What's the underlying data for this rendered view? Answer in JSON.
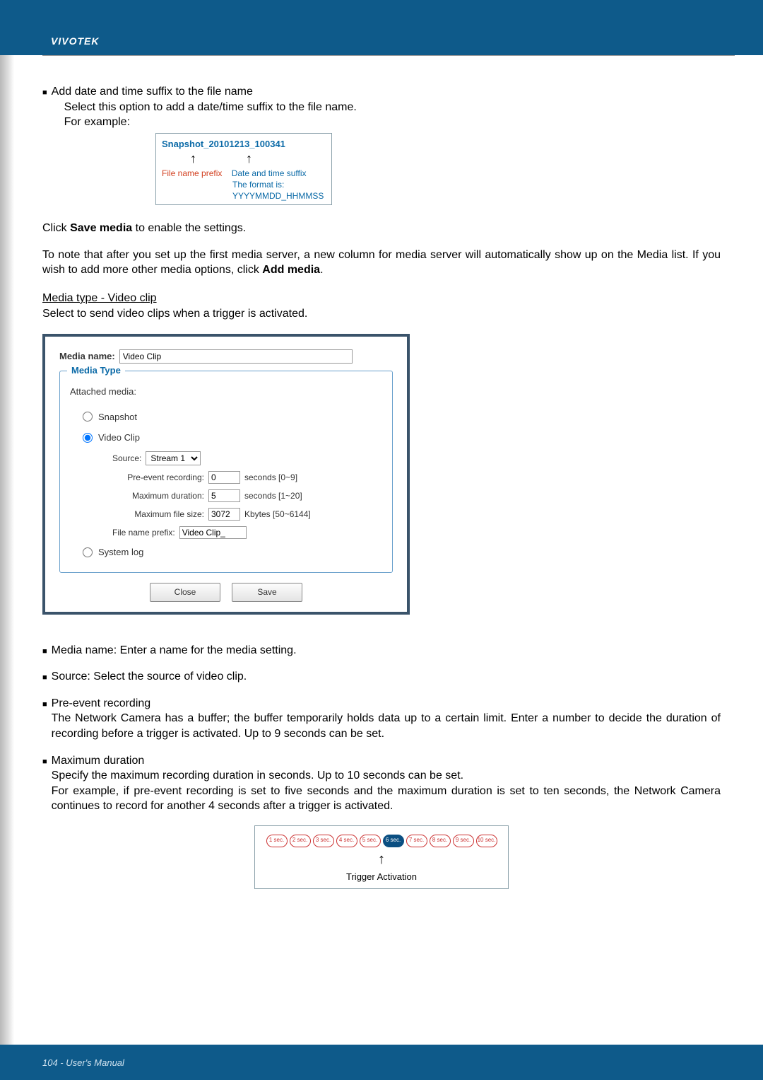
{
  "brand": "VIVOTEK",
  "intro": {
    "bullet_title": "Add date and time suffix to the file name",
    "line1": "Select this option to add a date/time suffix to the file name.",
    "line2": "For example:"
  },
  "example": {
    "snapshot": "Snapshot_20101213_100341",
    "label_prefix": "File name prefix",
    "label_suffix": "Date and time suffix",
    "label_format": "The format is: YYYYMMDD_HHMMSS"
  },
  "save_line_pre": "Click ",
  "save_bold": "Save media",
  "save_line_post": " to enable the settings.",
  "note_line_pre": "To note that after you set up the first media server, a new column for media server will automatically show up on the Media list.  If you wish to add more other media options, click ",
  "note_bold": "Add media",
  "note_line_post": ".",
  "media_header": "Media type - Video clip",
  "media_sub": "Select to send video clips when a trigger is activated.",
  "dialog": {
    "media_name_label": "Media name:",
    "media_name_value": "Video Clip",
    "media_type_legend": "Media Type",
    "attached_label": "Attached media:",
    "opt_snapshot": "Snapshot",
    "opt_videoclip": "Video Clip",
    "opt_systemlog": "System log",
    "source_label": "Source:",
    "source_value": "Stream 1",
    "pre_label": "Pre-event recording:",
    "pre_value": "0",
    "pre_suffix": "seconds [0~9]",
    "maxdur_label": "Maximum duration:",
    "maxdur_value": "5",
    "maxdur_suffix": "seconds [1~20]",
    "maxsize_label": "Maximum file size:",
    "maxsize_value": "3072",
    "maxsize_suffix": "Kbytes [50~6144]",
    "prefix_label": "File name prefix:",
    "prefix_value": "Video Clip_",
    "btn_close": "Close",
    "btn_save": "Save"
  },
  "notes": {
    "n1": "Media name: Enter a name for the media setting.",
    "n2": "Source: Select the source of video clip.",
    "n3_title": "Pre-event recording",
    "n3_body": "The Network Camera has a buffer; the buffer temporarily holds data up to a certain limit. Enter a number to decide the duration of recording before a trigger is activated. Up to 9 seconds can be set.",
    "n4_title": "Maximum duration",
    "n4_line1": "Specify the maximum recording duration in seconds. Up to 10 seconds can be set.",
    "n4_line2": "For example, if pre-event recording is set to five seconds and the maximum duration is set to ten seconds, the Network Camera continues to record for another 4 seconds after a trigger is activated."
  },
  "trigger": {
    "seconds": [
      "1 sec.",
      "2 sec.",
      "3 sec.",
      "4 sec.",
      "5 sec.",
      "6 sec.",
      "7 sec.",
      "8 sec.",
      "9 sec.",
      "10 sec."
    ],
    "active_index": 5,
    "label": "Trigger Activation"
  },
  "footer": "104 - User's Manual"
}
